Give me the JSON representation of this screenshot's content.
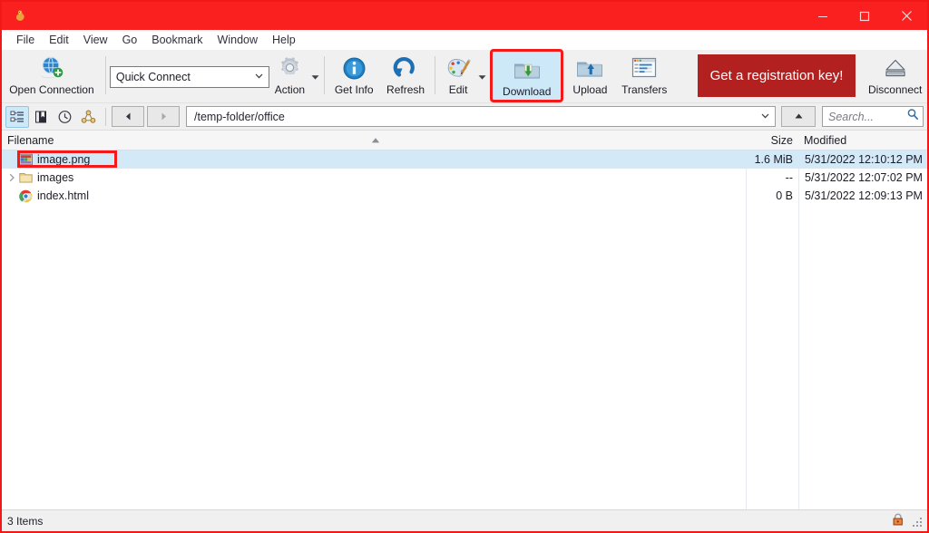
{
  "window": {
    "app_icon": "filezilla-icon",
    "title": "",
    "controls": [
      {
        "name": "minimize-button",
        "glyph": "minimize-icon"
      },
      {
        "name": "maximize-button",
        "glyph": "maximize-icon"
      },
      {
        "name": "close-button",
        "glyph": "close-icon"
      }
    ]
  },
  "menubar": {
    "items": [
      {
        "label": "File"
      },
      {
        "label": "Edit"
      },
      {
        "label": "View"
      },
      {
        "label": "Go"
      },
      {
        "label": "Bookmark"
      },
      {
        "label": "Window"
      },
      {
        "label": "Help"
      }
    ]
  },
  "toolbar": {
    "open_connection": {
      "label": "Open Connection",
      "icon": "globe-connection-icon"
    },
    "quick_connect": {
      "value": "Quick Connect",
      "icon": "chevron-down-icon"
    },
    "action": {
      "label": "Action",
      "icon": "gear-icon"
    },
    "get_info": {
      "label": "Get Info",
      "icon": "info-icon"
    },
    "refresh": {
      "label": "Refresh",
      "icon": "refresh-icon"
    },
    "edit": {
      "label": "Edit",
      "icon": "paint-palette-icon"
    },
    "download": {
      "label": "Download",
      "icon": "folder-download-icon",
      "selected": true,
      "highlighted": true
    },
    "upload": {
      "label": "Upload",
      "icon": "folder-upload-icon"
    },
    "transfers": {
      "label": "Transfers",
      "icon": "transfers-window-icon"
    },
    "registration_key": {
      "label": "Get a registration key!",
      "color": "#b32020"
    },
    "disconnect": {
      "label": "Disconnect",
      "icon": "eject-icon"
    }
  },
  "navbar": {
    "tree_toggle": {
      "icon": "tree-view-icon",
      "active": true
    },
    "bookmarks": {
      "icon": "bookmark-icon"
    },
    "history": {
      "icon": "clock-history-icon"
    },
    "sitemap": {
      "icon": "sitemap-icon"
    },
    "back": {
      "icon": "arrow-left-icon"
    },
    "forward": {
      "icon": "arrow-right-icon"
    },
    "path": {
      "value": "/temp-folder/office",
      "icon": "chevron-down-icon"
    },
    "parent": {
      "icon": "arrow-up-icon"
    },
    "search": {
      "placeholder": "Search...",
      "value": "",
      "icon": "search-icon"
    }
  },
  "filelist": {
    "columns": [
      {
        "key": "name",
        "label": "Filename"
      },
      {
        "key": "size",
        "label": "Size"
      },
      {
        "key": "modified",
        "label": "Modified"
      }
    ],
    "sort_indicator": "ascending-caret",
    "rows": [
      {
        "name": "image.png",
        "size": "1.6 MiB",
        "modified": "5/31/2022 12:10:12 PM",
        "icon": "image-file-icon",
        "selected": true,
        "highlighted": true,
        "expandable": false
      },
      {
        "name": "images",
        "size": "--",
        "modified": "5/31/2022 12:07:02 PM",
        "icon": "folder-icon",
        "selected": false,
        "highlighted": false,
        "expandable": true
      },
      {
        "name": "index.html",
        "size": "0 B",
        "modified": "5/31/2022 12:09:13 PM",
        "icon": "chrome-html-icon",
        "selected": false,
        "highlighted": false,
        "expandable": false
      }
    ]
  },
  "statusbar": {
    "items_text": "3 Items",
    "lock_icon": "padlock-icon",
    "grip": "resize-grip"
  },
  "colors": {
    "titlebar": "#fb2020",
    "annotation": "#f21a1a",
    "selection": "#d4e9f7",
    "registration": "#b32020"
  }
}
